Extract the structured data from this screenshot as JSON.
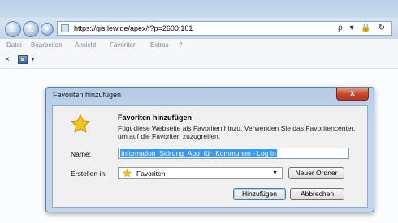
{
  "browser": {
    "url": "https://gis.lew.de/apex/f?p=2600:101",
    "url_right_icons": "ρ ▾ 🔒 ↻"
  },
  "menu": [
    "Datei",
    "Bearbeiten",
    "Ansicht",
    "Favoriten",
    "Extras",
    "?"
  ],
  "dialog": {
    "title": "Favoriten hinzufügen",
    "close_label": "x",
    "header_title": "Favoriten hinzufügen",
    "header_description": "Fügt diese Webseite als Favoriten hinzu. Verwenden Sie das Favoritencenter, um auf die Favoriten zuzugreifen.",
    "name_label": "Name:",
    "name_value": "Information_Störung_App_für_Kommunen - Log In",
    "create_in_label": "Erstellen in:",
    "create_in_value": "Favoriten",
    "new_folder_button": "Neuer Ordner",
    "add_button": "Hinzufügen",
    "cancel_button": "Abbrechen"
  },
  "colors": {
    "titlebar": "#b9d1ea",
    "selection": "#3399ff",
    "close_button": "#c8452a",
    "star": "#f5c518"
  }
}
